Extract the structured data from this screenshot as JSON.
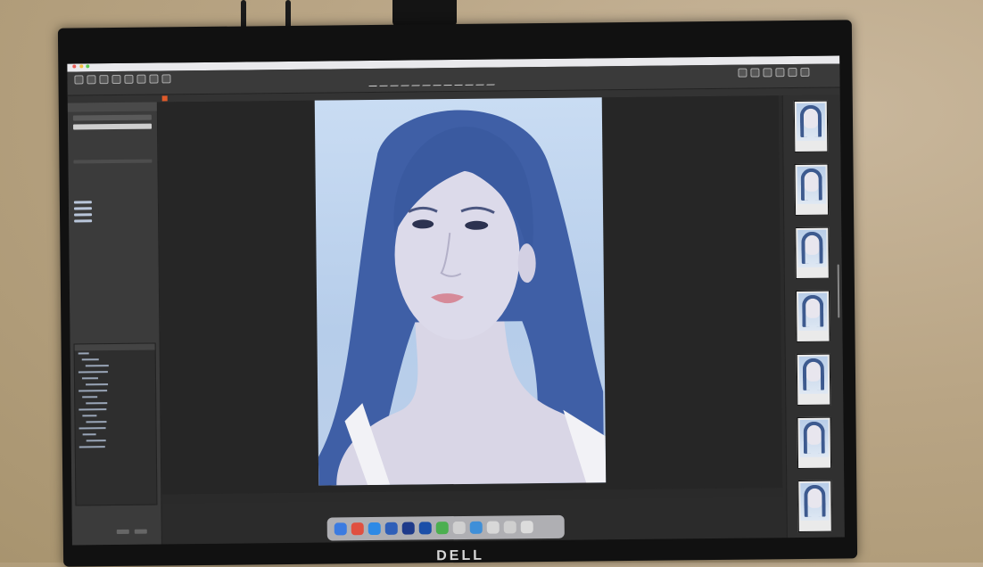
{
  "monitor": {
    "brand": "DELL"
  },
  "app": {
    "window_title": ""
  },
  "toolbar": {
    "left_buttons": [
      "",
      "",
      "",
      "",
      "",
      "",
      "",
      ""
    ],
    "center_label": "",
    "right_buttons": [
      "",
      "",
      "",
      "",
      "",
      ""
    ]
  },
  "left_panel": {
    "header": "",
    "tree_items": [
      "",
      "",
      "",
      "",
      "",
      "",
      "",
      "",
      "",
      "",
      "",
      "",
      "",
      "",
      "",
      ""
    ]
  },
  "thumbnails": [
    {
      "caption": ""
    },
    {
      "caption": ""
    },
    {
      "caption": ""
    },
    {
      "caption": ""
    },
    {
      "caption": ""
    },
    {
      "caption": ""
    },
    {
      "caption": ""
    }
  ],
  "dock": {
    "apps": [
      {
        "icon": "finder-icon",
        "color": "#3b7be0"
      },
      {
        "icon": "chrome-icon",
        "color": "#e05040"
      },
      {
        "icon": "safari-icon",
        "color": "#2d8ae6"
      },
      {
        "icon": "app-icon",
        "color": "#2f5fb8"
      },
      {
        "icon": "photoshop-icon",
        "color": "#1e3a8a"
      },
      {
        "icon": "app-icon",
        "color": "#1b4fa8"
      },
      {
        "icon": "messages-icon",
        "color": "#4caf50"
      },
      {
        "icon": "app-icon",
        "color": "#d0d0d0"
      },
      {
        "icon": "chart-icon",
        "color": "#3f8fd8"
      },
      {
        "icon": "app-icon",
        "color": "#d8d8d8"
      },
      {
        "icon": "app-icon",
        "color": "#cfcfcf"
      },
      {
        "icon": "trash-icon",
        "color": "#dcdcdc"
      }
    ]
  },
  "colors": {
    "accent": "#e05a2a",
    "workspace": "#262626",
    "panel": "#3b3b3b"
  }
}
